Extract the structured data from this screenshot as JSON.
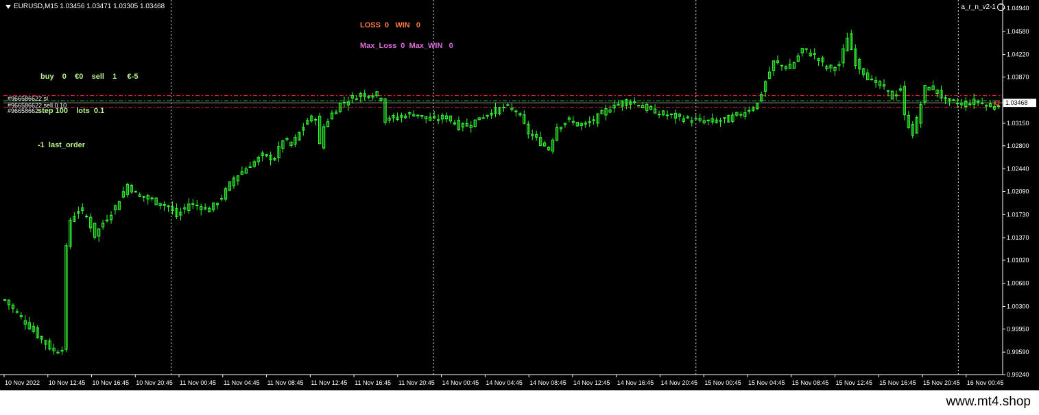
{
  "window": {
    "symbol_header": "EURUSD,M15  1.03456 1.03471 1.03305 1.03468",
    "ea_name": "a_r_n_v2-1"
  },
  "overlay": {
    "loss_win": "LOSS  0   WIN   0",
    "max_loss_win": "Max_Loss  0  Max_WIN   0",
    "buy_sell": "buy    0    €0    sell    1     €-5",
    "step_lots": "step 100    lots  0.1",
    "last_order": "-1  last_order"
  },
  "orders": {
    "sl_label": "#966586622 sl",
    "sell_label": "#966586622 sell 0.10",
    "tp_label": "#96658662"
  },
  "footer": {
    "site": "www.mt4.shop"
  },
  "colors": {
    "background": "#000000",
    "candle": "#33ff33",
    "grid": "#ffffff",
    "loss_win": "#ff7a47",
    "max_stats": "#e06ee0",
    "info": "#b6f28a",
    "order_line": "#ff2020",
    "entry_line": "#22cc22"
  },
  "chart_data": {
    "type": "candlestick",
    "symbol": "EURUSD",
    "timeframe": "M15",
    "current_price": "1.03468",
    "ylim": [
      0.9924,
      1.0494
    ],
    "price_ticks": [
      "1.04940",
      "1.04580",
      "1.04220",
      "1.03870",
      "1.03468",
      "1.03150",
      "1.02800",
      "1.02440",
      "1.02090",
      "1.01730",
      "1.01370",
      "1.01020",
      "1.00660",
      "1.00300",
      "0.99950",
      "0.99590",
      "0.99240"
    ],
    "time_labels": [
      "10 Nov 2022",
      "10 Nov 12:45",
      "10 Nov 16:45",
      "10 Nov 20:45",
      "11 Nov 00:45",
      "11 Nov 04:45",
      "11 Nov 08:45",
      "11 Nov 12:45",
      "11 Nov 16:45",
      "11 Nov 20:45",
      "14 Nov 00:45",
      "14 Nov 04:45",
      "14 Nov 08:45",
      "14 Nov 12:45",
      "14 Nov 16:45",
      "14 Nov 20:45",
      "15 Nov 00:45",
      "15 Nov 04:45",
      "15 Nov 08:45",
      "15 Nov 12:45",
      "15 Nov 16:45",
      "15 Nov 20:45",
      "16 Nov 00:45"
    ],
    "day_separators_at": [
      "10 Nov 20:45",
      "11 Nov 20:45",
      "14 Nov 20:45",
      "15 Nov 20:45"
    ],
    "order_lines": {
      "sl": 1.0358,
      "entry": 1.035,
      "tp": 1.034
    },
    "close_path": [
      [
        0,
        1.004
      ],
      [
        8,
        0.9985
      ],
      [
        12,
        0.996
      ],
      [
        14,
        0.9965
      ],
      [
        15,
        1.012
      ],
      [
        16,
        1.0165
      ],
      [
        18,
        1.018
      ],
      [
        20,
        1.017
      ],
      [
        22,
        1.014
      ],
      [
        24,
        1.016
      ],
      [
        27,
        1.0185
      ],
      [
        30,
        1.022
      ],
      [
        32,
        1.0205
      ],
      [
        36,
        1.0195
      ],
      [
        40,
        1.0185
      ],
      [
        42,
        1.017
      ],
      [
        45,
        1.019
      ],
      [
        48,
        1.0185
      ],
      [
        50,
        1.018
      ],
      [
        53,
        1.02
      ],
      [
        56,
        1.023
      ],
      [
        60,
        1.025
      ],
      [
        63,
        1.0265
      ],
      [
        66,
        1.026
      ],
      [
        68,
        1.029
      ],
      [
        70,
        1.028
      ],
      [
        72,
        1.03
      ],
      [
        74,
        1.032
      ],
      [
        76,
        1.0325
      ],
      [
        77,
        1.028
      ],
      [
        78,
        1.031
      ],
      [
        80,
        1.033
      ],
      [
        82,
        1.0345
      ],
      [
        85,
        1.0355
      ],
      [
        87,
        1.036
      ],
      [
        90,
        1.036
      ],
      [
        92,
        1.0355
      ],
      [
        93,
        1.032
      ],
      [
        96,
        1.0325
      ],
      [
        100,
        1.033
      ],
      [
        104,
        1.032
      ],
      [
        108,
        1.0325
      ],
      [
        111,
        1.031
      ],
      [
        114,
        1.0315
      ],
      [
        118,
        1.033
      ],
      [
        122,
        1.034
      ],
      [
        125,
        1.0335
      ],
      [
        128,
        1.03
      ],
      [
        131,
        1.0285
      ],
      [
        133,
        1.0275
      ],
      [
        135,
        1.031
      ],
      [
        138,
        1.032
      ],
      [
        141,
        1.031
      ],
      [
        144,
        1.032
      ],
      [
        148,
        1.034
      ],
      [
        152,
        1.035
      ],
      [
        155,
        1.0345
      ],
      [
        156,
        1.034
      ],
      [
        160,
        1.033
      ],
      [
        164,
        1.0325
      ],
      [
        168,
        1.032
      ],
      [
        172,
        1.0318
      ],
      [
        176,
        1.032
      ],
      [
        180,
        1.033
      ],
      [
        184,
        1.0345
      ],
      [
        186,
        1.038
      ],
      [
        188,
        1.041
      ],
      [
        192,
        1.04
      ],
      [
        195,
        1.043
      ],
      [
        198,
        1.042
      ],
      [
        201,
        1.04
      ],
      [
        204,
        1.0405
      ],
      [
        206,
        1.045
      ],
      [
        208,
        1.041
      ],
      [
        210,
        1.0395
      ],
      [
        212,
        1.038
      ],
      [
        215,
        1.037
      ],
      [
        217,
        1.0355
      ],
      [
        219,
        1.037
      ],
      [
        220,
        1.0325
      ],
      [
        222,
        1.03
      ],
      [
        223,
        1.032
      ],
      [
        225,
        1.037
      ],
      [
        227,
        1.037
      ],
      [
        230,
        1.035
      ],
      [
        234,
        1.0345
      ],
      [
        238,
        1.035
      ],
      [
        241,
        1.034
      ],
      [
        243,
        1.0347
      ]
    ]
  }
}
